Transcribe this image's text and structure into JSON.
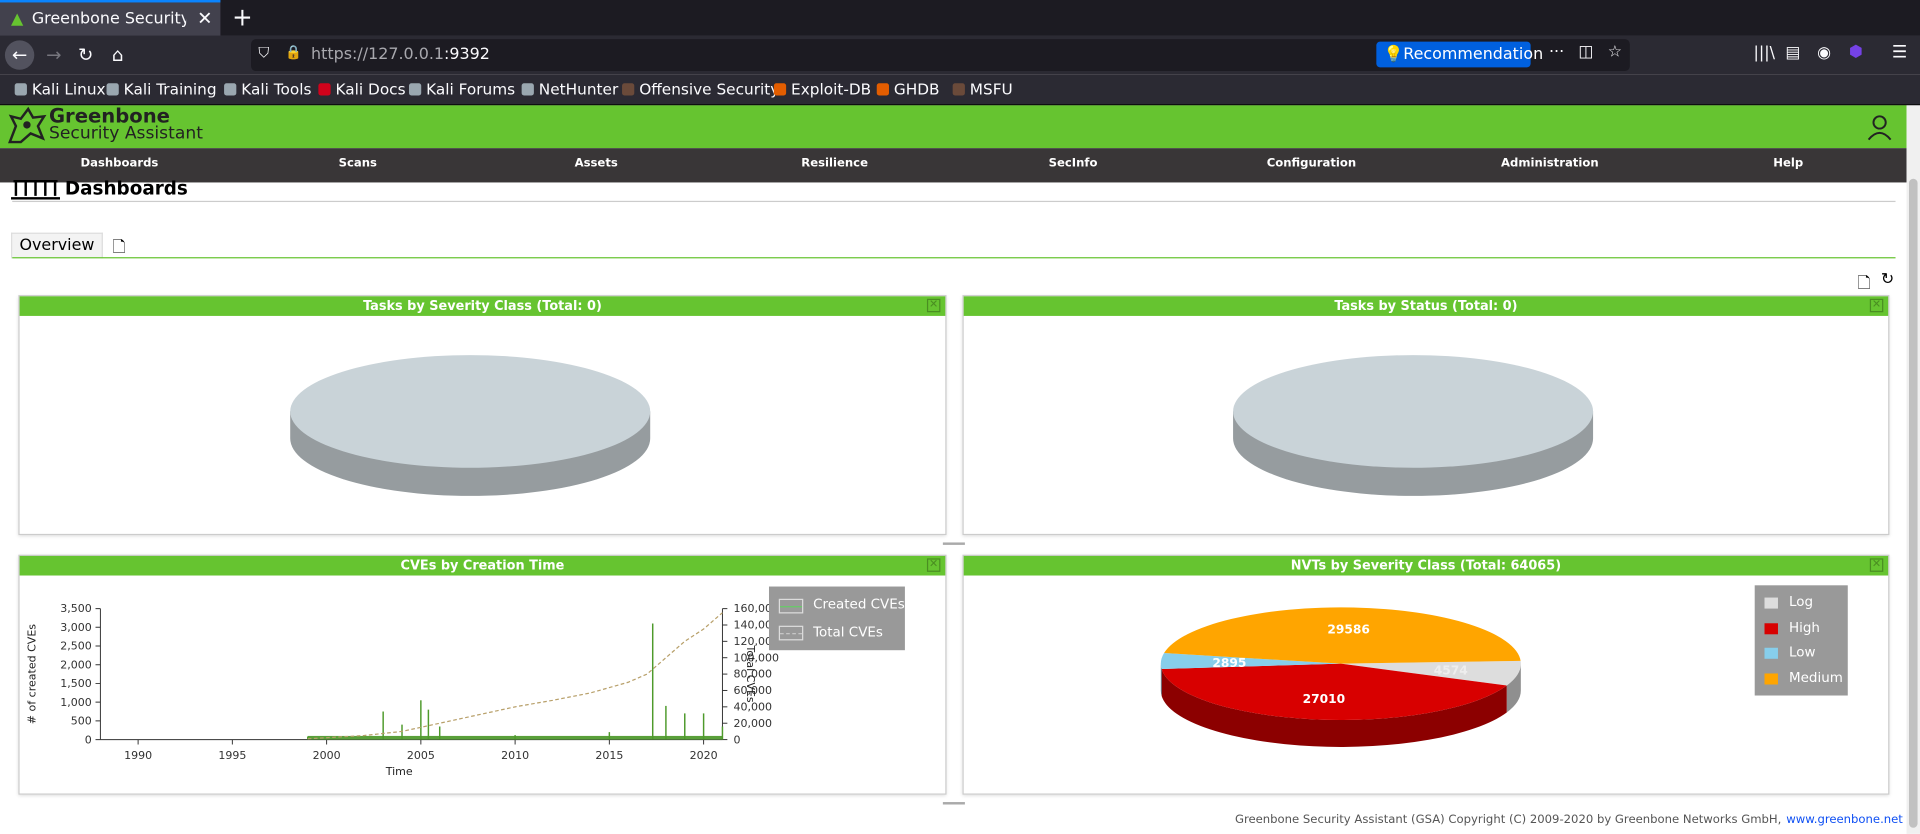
{
  "browser": {
    "tab_title": "Greenbone Security Assistant",
    "url_host": "https://127.0.0.1",
    "url_port": ":9392",
    "recommendation": "Recommendation"
  },
  "bookmarks": [
    {
      "label": "Kali Linux",
      "color": "#9aa7b0"
    },
    {
      "label": "Kali Training",
      "color": "#9aa7b0"
    },
    {
      "label": "Kali Tools",
      "color": "#9aa7b0"
    },
    {
      "label": "Kali Docs",
      "color": "#d0021b"
    },
    {
      "label": "Kali Forums",
      "color": "#9aa7b0"
    },
    {
      "label": "NetHunter",
      "color": "#9aa7b0"
    },
    {
      "label": "Offensive Security",
      "color": "#6a4a3a"
    },
    {
      "label": "Exploit-DB",
      "color": "#e35d00"
    },
    {
      "label": "GHDB",
      "color": "#e35d00"
    },
    {
      "label": "MSFU",
      "color": "#6a4a3a"
    }
  ],
  "gsa": {
    "logo_line1": "Greenbone",
    "logo_line2": "Security Assistant",
    "menu": [
      "Dashboards",
      "Scans",
      "Assets",
      "Resilience",
      "SecInfo",
      "Configuration",
      "Administration",
      "Help"
    ]
  },
  "page": {
    "title": "Dashboards",
    "tab": "Overview"
  },
  "panels": {
    "tasks_severity": {
      "title": "Tasks by Severity Class (Total: 0)"
    },
    "tasks_status": {
      "title": "Tasks by Status (Total: 0)"
    },
    "cves": {
      "title": "CVEs by Creation Time",
      "legend": [
        "Created CVEs",
        "Total CVEs"
      ],
      "ylabel_left": "# of created CVEs",
      "ylabel_right": "Total CVEs",
      "xlabel": "Time",
      "yticks_left": [
        "3,500",
        "3,000",
        "2,500",
        "2,000",
        "1,500",
        "1,000",
        "500",
        "0"
      ],
      "yticks_right": [
        "160,000",
        "140,000",
        "120,000",
        "100,000",
        "80,000",
        "60,000",
        "40,000",
        "20,000",
        "0"
      ],
      "xticks": [
        "1990",
        "1995",
        "2000",
        "2005",
        "2010",
        "2015",
        "2020"
      ]
    },
    "nvts": {
      "title": "NVTs by Severity Class (Total: 64065)",
      "legend": [
        {
          "label": "Log",
          "color": "#dddddd"
        },
        {
          "label": "High",
          "color": "#d80000"
        },
        {
          "label": "Low",
          "color": "#87ceeb"
        },
        {
          "label": "Medium",
          "color": "#ffa500"
        }
      ]
    }
  },
  "chart_data": [
    {
      "type": "pie",
      "title": "Tasks by Severity Class (Total: 0)",
      "values": []
    },
    {
      "type": "pie",
      "title": "Tasks by Status (Total: 0)",
      "values": []
    },
    {
      "type": "line",
      "title": "CVEs by Creation Time",
      "xlabel": "Time",
      "ylabel": "# of created CVEs",
      "y2label": "Total CVEs",
      "xlim": [
        1988,
        2021
      ],
      "ylim": [
        0,
        3500
      ],
      "y2lim": [
        0,
        160000
      ],
      "series": [
        {
          "name": "Created CVEs",
          "x": [
            1999,
            2003,
            2004,
            2005,
            2005.4,
            2006,
            2010,
            2015,
            2017.3,
            2018,
            2019,
            2020,
            2021
          ],
          "y": [
            80,
            750,
            400,
            1050,
            800,
            350,
            120,
            200,
            3100,
            900,
            700,
            700,
            350
          ]
        },
        {
          "name": "Total CVEs",
          "x": [
            1999,
            2002,
            2004,
            2006,
            2008,
            2010,
            2012,
            2014,
            2016,
            2017,
            2018,
            2019,
            2020,
            2021
          ],
          "y": [
            1000,
            5000,
            10000,
            20000,
            30000,
            40000,
            48000,
            57000,
            70000,
            80000,
            100000,
            120000,
            135000,
            155000
          ]
        }
      ]
    },
    {
      "type": "pie",
      "title": "NVTs by Severity Class (Total: 64065)",
      "categories": [
        "Log",
        "High",
        "Low",
        "Medium"
      ],
      "values": [
        4574,
        27010,
        2895,
        29586
      ],
      "colors": [
        "#dddddd",
        "#d80000",
        "#87ceeb",
        "#ffa500"
      ]
    }
  ],
  "footer": {
    "text": "Greenbone Security Assistant (GSA) Copyright (C) 2009-2020 by Greenbone Networks GmbH,",
    "link": "www.greenbone.net"
  }
}
